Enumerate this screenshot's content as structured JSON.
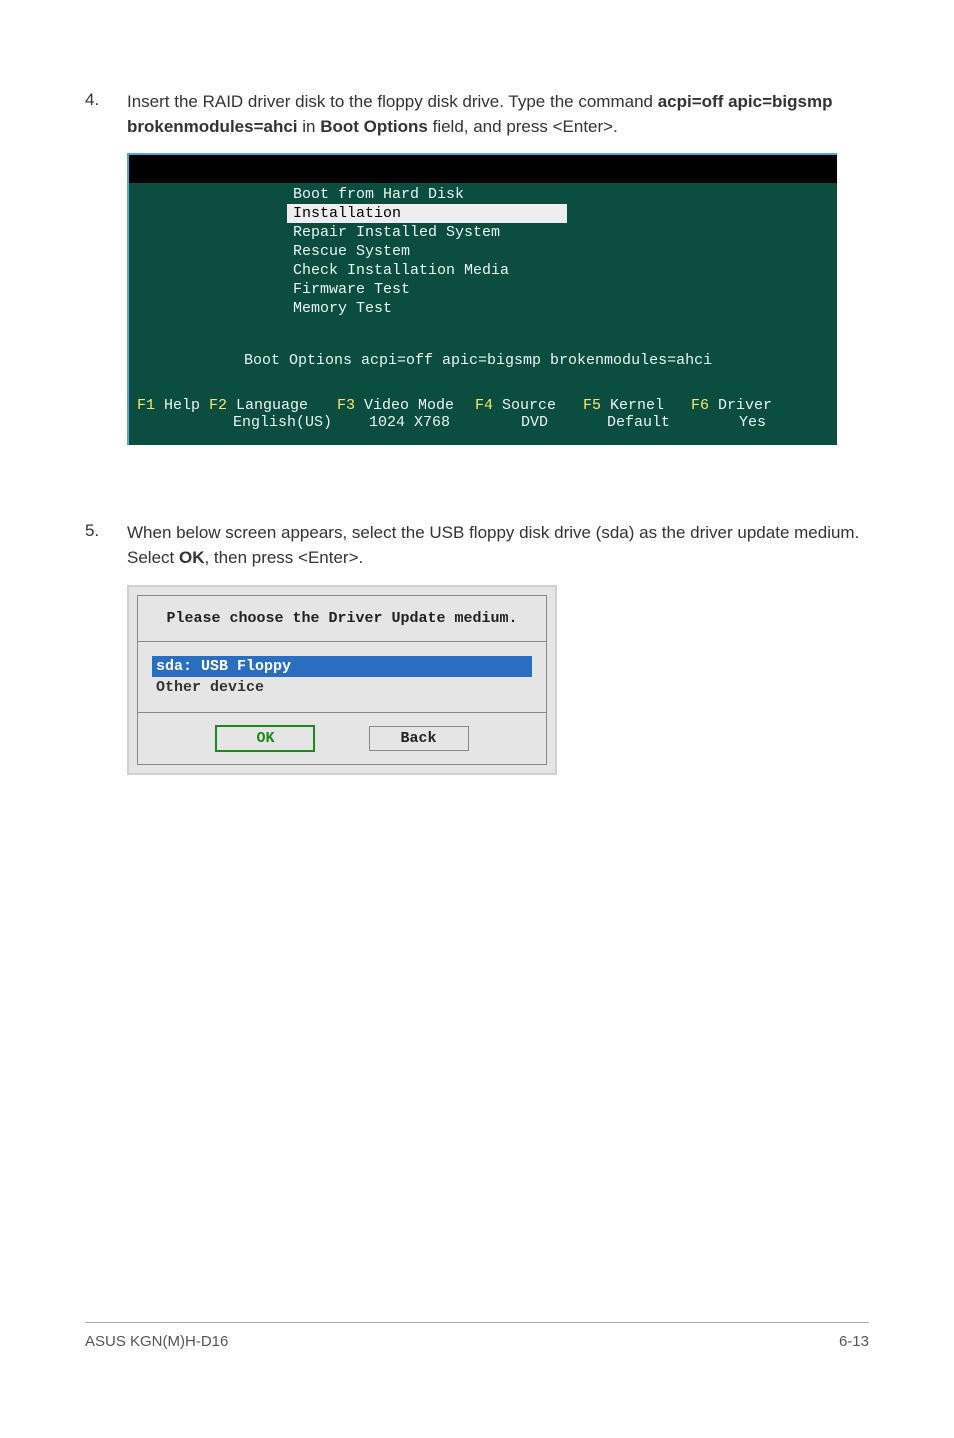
{
  "step4": {
    "num": "4.",
    "text_pre": "Insert the RAID driver disk to the floppy disk drive. Type the command ",
    "cmd": "acpi=off apic=bigsmp brokenmodules=ahci",
    "text_mid": " in ",
    "bold2": "Boot Options",
    "text_end": " field, and press <Enter>."
  },
  "boot": {
    "menu": [
      "Boot from Hard Disk",
      "Installation",
      "Repair Installed System",
      "Rescue System",
      "Check Installation Media",
      "Firmware Test",
      "Memory Test"
    ],
    "selected_index": 1,
    "options_line": "Boot Options acpi=off apic=bigsmp brokenmodules=ahci",
    "fkeys": {
      "f1": {
        "k": "F1",
        "lbl": "Help",
        "sub": ""
      },
      "f2": {
        "k": "F2",
        "lbl": "Language",
        "sub": "English(US)"
      },
      "f3": {
        "k": "F3",
        "lbl": "Video Mode",
        "sub": "1024 X768"
      },
      "f4": {
        "k": "F4",
        "lbl": "Source",
        "sub": "DVD"
      },
      "f5": {
        "k": "F5",
        "lbl": "Kernel",
        "sub": "Default"
      },
      "f6": {
        "k": "F6",
        "lbl": "Driver",
        "sub": "Yes"
      }
    }
  },
  "step5": {
    "num": "5.",
    "text_pre": "When below screen appears, select the USB floppy disk drive (sda) as the driver update medium. Select ",
    "bold": "OK",
    "text_end": ", then press <Enter>."
  },
  "dialog": {
    "title": "Please choose the Driver Update medium.",
    "items": [
      "sda: USB Floppy",
      "Other device"
    ],
    "selected_index": 0,
    "ok": "OK",
    "back": "Back"
  },
  "footer": {
    "left": "ASUS KGN(M)H-D16",
    "right": "6-13"
  }
}
